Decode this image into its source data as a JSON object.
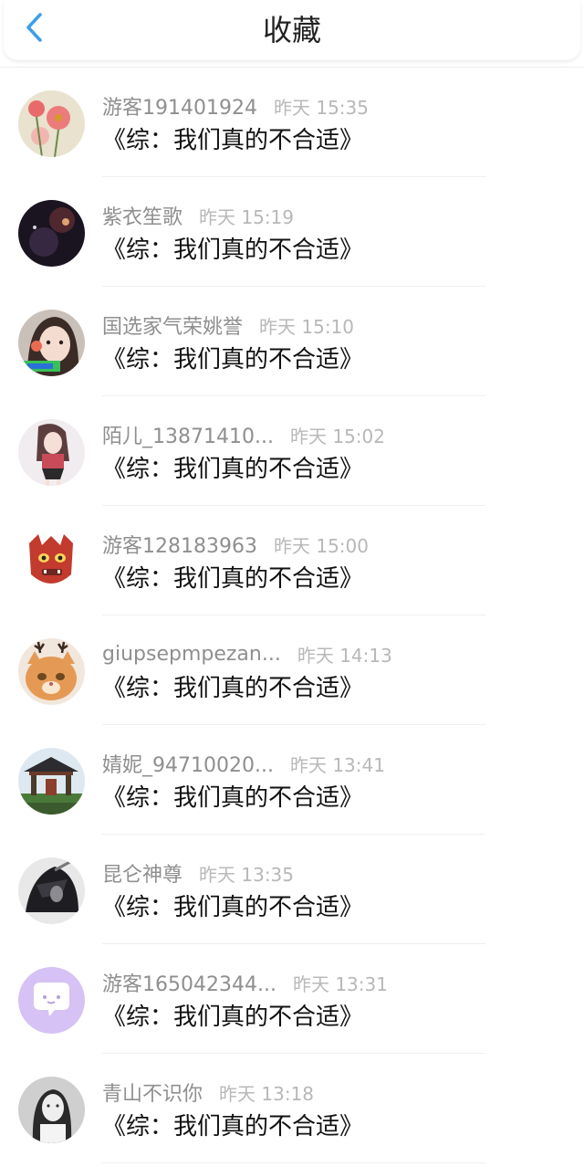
{
  "header": {
    "title": "收藏",
    "back_icon": "chevron-left-icon",
    "accent": "#3a9eea"
  },
  "items": [
    {
      "user": "游客191401924",
      "time": "昨天 15:35",
      "title": "《综：我们真的不合适》",
      "avatar": "flower"
    },
    {
      "user": "紫衣笙歌",
      "time": "昨天 15:19",
      "title": "《综：我们真的不合适》",
      "avatar": "dark-galaxy"
    },
    {
      "user": "国选家气荣姚誉",
      "time": "昨天 15:10",
      "title": "《综：我们真的不合适》",
      "avatar": "girl-portrait"
    },
    {
      "user": "陌儿_13871410...",
      "time": "昨天 15:02",
      "title": "《综：我们真的不合适》",
      "avatar": "anime-girl"
    },
    {
      "user": "游客128183963",
      "time": "昨天 15:00",
      "title": "《综：我们真的不合适》",
      "avatar": "red-mask"
    },
    {
      "user": "giupsepmpezan...",
      "time": "昨天 14:13",
      "title": "《综：我们真的不合适》",
      "avatar": "cat-antlers"
    },
    {
      "user": "婧妮_94710020...",
      "time": "昨天 13:41",
      "title": "《综：我们真的不合适》",
      "avatar": "temple"
    },
    {
      "user": "昆仑神尊",
      "time": "昨天 13:35",
      "title": "《综：我们真的不合适》",
      "avatar": "dark-warrior"
    },
    {
      "user": "游客165042344...",
      "time": "昨天 13:31",
      "title": "《综：我们真的不合适》",
      "avatar": "chat-bubble"
    },
    {
      "user": "青山不识你",
      "time": "昨天 13:18",
      "title": "《综：我们真的不合适》",
      "avatar": "girl-bw"
    }
  ]
}
